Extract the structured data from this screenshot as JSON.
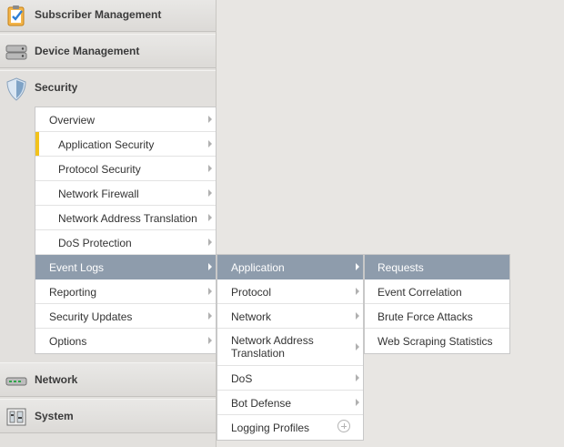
{
  "sidebar": {
    "sections": [
      {
        "label": "Subscriber Management",
        "icon": "clipboard-check-icon"
      },
      {
        "label": "Device Management",
        "icon": "server-drives-icon"
      },
      {
        "label": "Security",
        "icon": "shield-icon"
      },
      {
        "label": "Network",
        "icon": "network-switch-icon"
      },
      {
        "label": "System",
        "icon": "system-panel-icon"
      }
    ]
  },
  "security_menu": {
    "items": [
      {
        "label": "Overview"
      },
      {
        "label": "Application Security"
      },
      {
        "label": "Protocol Security"
      },
      {
        "label": "Network Firewall"
      },
      {
        "label": "Network Address Translation"
      },
      {
        "label": "DoS Protection"
      },
      {
        "label": "Event Logs"
      },
      {
        "label": "Reporting"
      },
      {
        "label": "Security Updates"
      },
      {
        "label": "Options"
      }
    ]
  },
  "event_logs_menu": {
    "items": [
      {
        "label": "Application"
      },
      {
        "label": "Protocol"
      },
      {
        "label": "Network"
      },
      {
        "label": "Network Address",
        "label2": "Translation"
      },
      {
        "label": "DoS"
      },
      {
        "label": "Bot Defense"
      },
      {
        "label": "Logging Profiles"
      }
    ]
  },
  "application_menu": {
    "items": [
      {
        "label": "Requests"
      },
      {
        "label": "Event Correlation"
      },
      {
        "label": "Brute Force Attacks"
      },
      {
        "label": "Web Scraping Statistics"
      }
    ]
  },
  "colors": {
    "active_item": "#8e9cac",
    "marker": "#f2c21b",
    "page_background": "#e8e6e3"
  }
}
